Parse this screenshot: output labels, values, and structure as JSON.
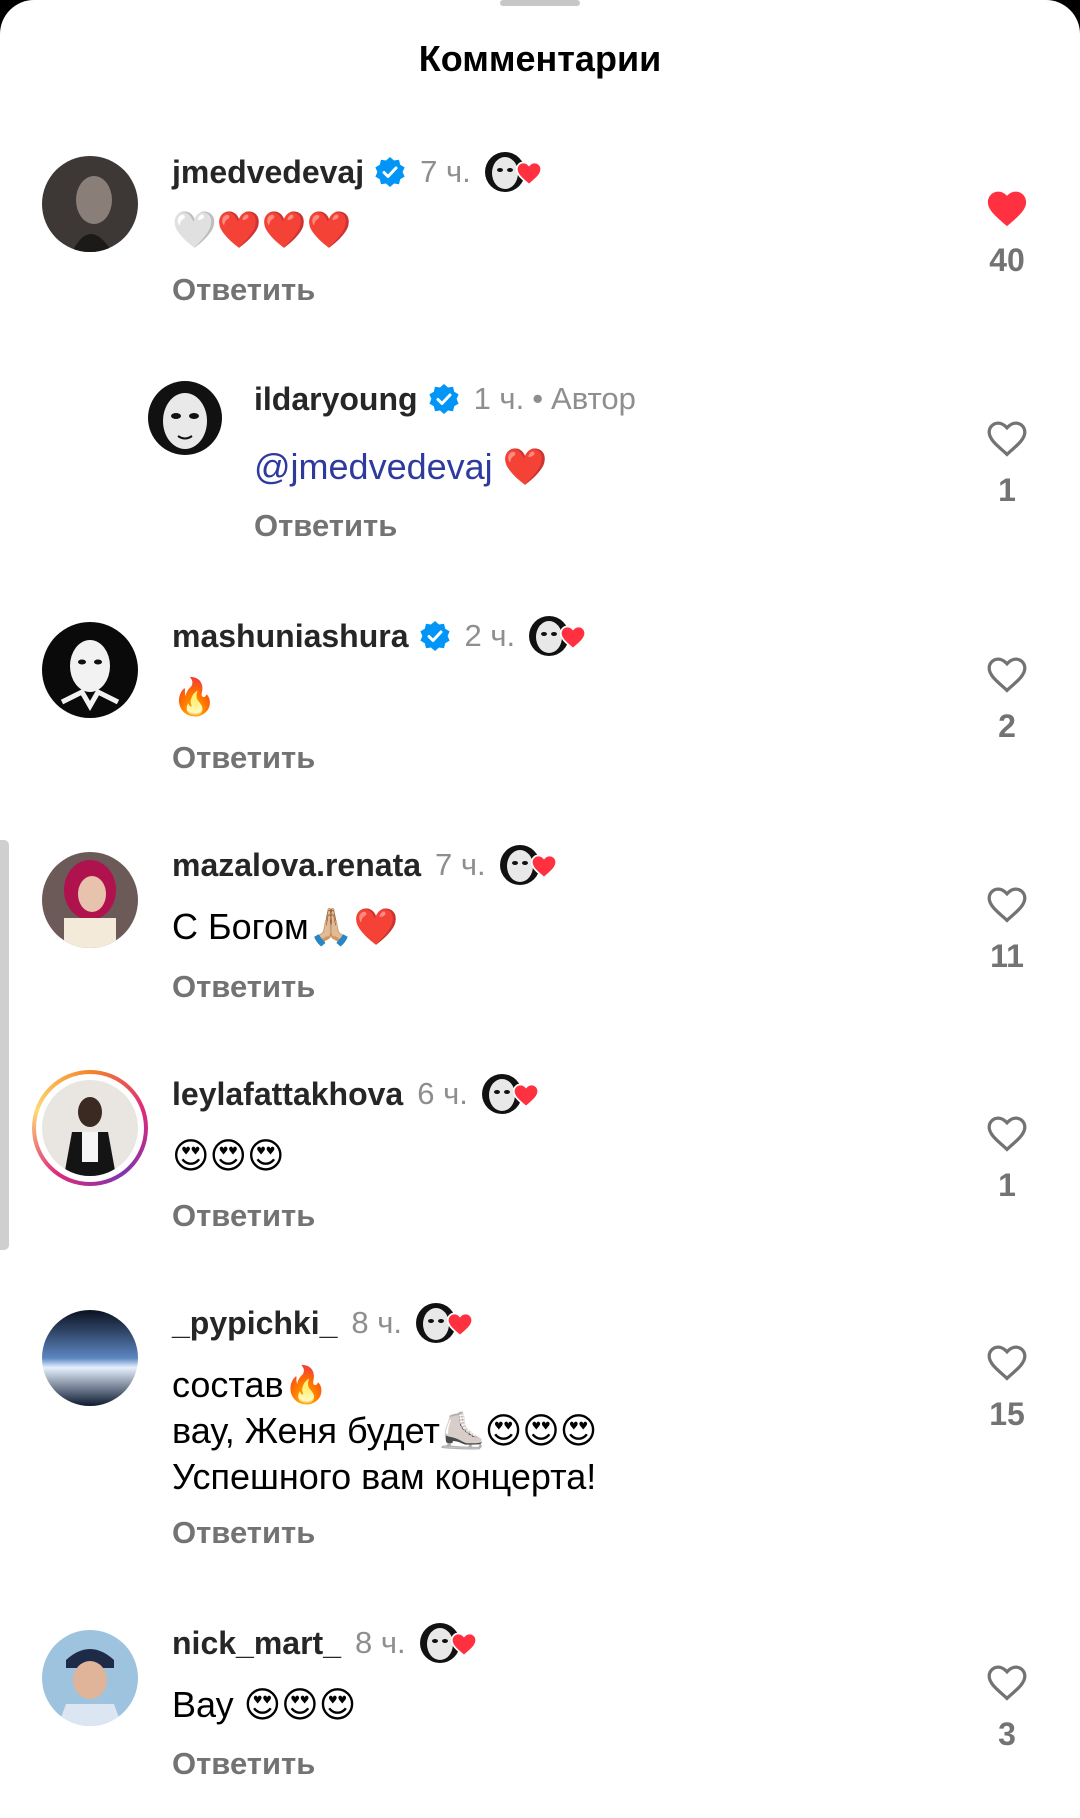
{
  "header": {
    "title": "Комментарии"
  },
  "reply_label": "Ответить",
  "colors": {
    "like_red": "#ff3040",
    "verified_blue": "#0095f6",
    "mention": "#2e3a9e",
    "secondary_text": "#737373"
  },
  "comments": [
    {
      "username": "jmedvedevaj",
      "verified": true,
      "time": "7 ч.",
      "text": "🤍❤️❤️❤️",
      "likes": "40",
      "liked": true,
      "liked_by_author": true
    },
    {
      "username": "ildaryoung",
      "verified": true,
      "time": "1 ч.",
      "dot": "•",
      "author_badge": "Автор",
      "mention": "@jmedvedevaj",
      "text": " ❤️",
      "likes": "1",
      "liked": false
    },
    {
      "username": "mashuniashura",
      "verified": true,
      "time": "2 ч.",
      "text": "🔥",
      "likes": "2",
      "liked": false,
      "liked_by_author": true
    },
    {
      "username": "mazalova.renata",
      "verified": false,
      "time": "7 ч.",
      "text": "С Богом🙏🏼❤️",
      "likes": "11",
      "liked": false,
      "liked_by_author": true
    },
    {
      "username": "leylafattakhova",
      "verified": false,
      "time": "6 ч.",
      "text": "😍😍😍",
      "likes": "1",
      "liked": false,
      "liked_by_author": true,
      "story_ring": true
    },
    {
      "username": "_pypichki_",
      "verified": false,
      "time": "8 ч.",
      "text": "состав🔥\nвау, Женя будет⛸️😍😍😍\nУспешного вам концерта!",
      "likes": "15",
      "liked": false,
      "liked_by_author": true
    },
    {
      "username": "nick_mart_",
      "verified": false,
      "time": "8 ч.",
      "text": "Вау 😍😍😍",
      "likes": "3",
      "liked": false,
      "liked_by_author": true
    }
  ]
}
